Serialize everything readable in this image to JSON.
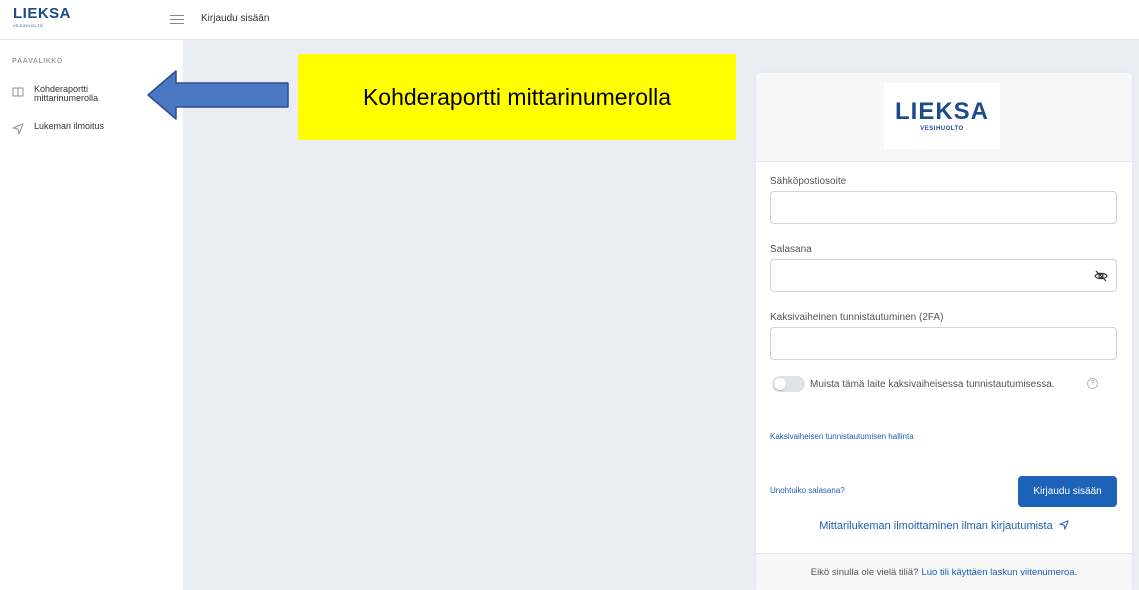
{
  "colors": {
    "brand": "#1c4a8a",
    "accent": "#1c62b9",
    "annotation_bg": "#ffff00",
    "page_bg": "#eaedf3"
  },
  "header": {
    "logo_brand": "LIEKSA",
    "logo_tag": "VESIHUOLTO",
    "page_title": "Kirjaudu sisään"
  },
  "sidebar": {
    "heading": "PÄÄVALIKKO",
    "items": [
      {
        "label": "Kohderaportti mittarinumerolla",
        "icon": "book-icon"
      },
      {
        "label": "Lukeman ilmoitus",
        "icon": "send-icon"
      }
    ]
  },
  "annotation": {
    "text": "Kohderaportti mittarinumerolla"
  },
  "login": {
    "logo_brand": "LIEKSA",
    "logo_tag": "VESIHUOLTO",
    "email_label": "Sähköpostiosoite",
    "email_value": "",
    "password_label": "Salasana",
    "password_value": "",
    "twofa_label": "Kaksivaiheinen tunnistautuminen (2FA)",
    "twofa_value": "",
    "remember_label": "Muista tämä laite kaksivaiheisessa tunnistautumisessa.",
    "remember_on": false,
    "help_mark": "?",
    "manage_2fa_link": "Kaksivaiheisen tunnistautumisen hallinta",
    "forgot_link": "Unohtuiko salasana?",
    "login_button": "Kirjaudu sisään",
    "guest_link": "Mittarilukeman ilmoittaminen ilman kirjautumista",
    "footer_text": "Eikö sinulla ole vielä tiliä?",
    "footer_link": "Luo tili käyttäen laskun viitenumeroa."
  }
}
